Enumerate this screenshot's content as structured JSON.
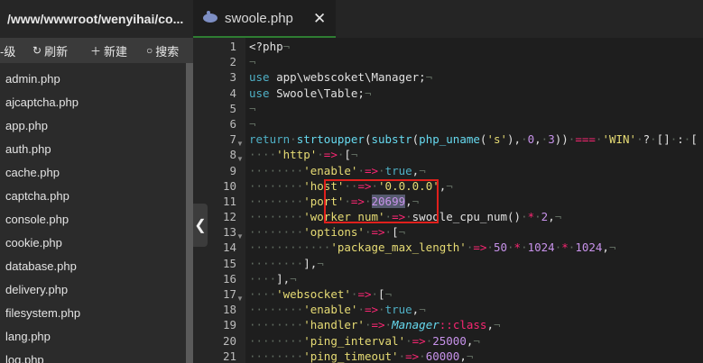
{
  "sidebar": {
    "path": "/www/wwwroot/wenyihai/co...",
    "toolbar": {
      "up_label": "-级",
      "refresh_label": "刷新",
      "new_label": "新建",
      "search_label": "搜索"
    },
    "files": [
      "admin.php",
      "ajcaptcha.php",
      "app.php",
      "auth.php",
      "cache.php",
      "captcha.php",
      "console.php",
      "cookie.php",
      "database.php",
      "delivery.php",
      "filesystem.php",
      "lang.php",
      "log.php"
    ]
  },
  "tab": {
    "title": "swoole.php",
    "close": "✕"
  },
  "collapse": "❮",
  "line_numbers": [
    "1",
    "2",
    "3",
    "4",
    "5",
    "6",
    "7",
    "8",
    "9",
    "10",
    "11",
    "12",
    "13",
    "14",
    "15",
    "16",
    "17",
    "18",
    "19",
    "20",
    "21"
  ],
  "code": {
    "l1": "<?php",
    "l3_kw": "use",
    "l3_rest": " app\\webscoket\\Manager;",
    "l4_kw": "use",
    "l4_rest": " Swoole\\Table;",
    "l7_kw": "return",
    "l7_f1": "strtoupper",
    "l7_f2": "substr",
    "l7_f3": "php_uname",
    "l7_s": "'s'",
    "l7_n1": "0",
    "l7_n2": "3",
    "l7_win": "'WIN'",
    "l8_key": "'http'",
    "l9_key": "'enable'",
    "l9_val": "true",
    "l10_key": "'host'",
    "l10_val": "'0.0.0.0'",
    "l11_key": "'port'",
    "l11_val": "20699",
    "l12_key": "'worker_num'",
    "l12_fn": "swoole_cpu_num",
    "l12_num": "2",
    "l13_key": "'options'",
    "l14_key": "'package_max_length'",
    "l14_n1": "50",
    "l14_n2": "1024",
    "l14_n3": "1024",
    "l17_key": "'websocket'",
    "l18_key": "'enable'",
    "l18_val": "true",
    "l19_key": "'handler'",
    "l19_cls": "Manager",
    "l19_rest": "::class",
    "l20_key": "'ping_interval'",
    "l20_val": "25000",
    "l21_key": "'ping_timeout'",
    "l21_val": "60000"
  },
  "colors": {
    "accent_tab_underline": "#2e7d32",
    "highlight_box": "#e0201c"
  }
}
